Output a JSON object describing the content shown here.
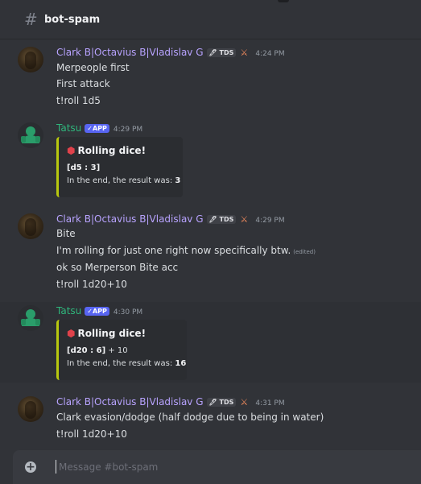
{
  "channel": {
    "name": "bot-spam"
  },
  "badges": {
    "tds": "TDS",
    "app": "✓APP"
  },
  "messages": [
    {
      "author": "Clark B|Octavius B|Vladislav G",
      "time": "4:24 PM",
      "lines": [
        "Merpeople first",
        "First attack",
        "t!roll 1d5"
      ]
    },
    {
      "author": "Tatsu",
      "time": "4:29 PM",
      "embed": {
        "title": "Rolling dice!",
        "detail_dice": "[d5 : 3]",
        "detail_rest": "",
        "result_prefix": "In the end, the result was: ",
        "result": "3"
      }
    },
    {
      "author": "Clark B|Octavius B|Vladislav G",
      "time": "4:29 PM",
      "lines": [
        "Bite",
        "I'm rolling for just one right now specifically btw.",
        "ok so Merperson Bite acc",
        "t!roll 1d20+10"
      ],
      "edited": "(edited)"
    },
    {
      "author": "Tatsu",
      "time": "4:30 PM",
      "embed": {
        "title": "Rolling dice!",
        "detail_dice": "[d20 : 6]",
        "detail_rest": " + 10",
        "result_prefix": "In the end, the result was: ",
        "result": "16"
      }
    },
    {
      "author": "Clark B|Octavius B|Vladislav G",
      "time": "4:31 PM",
      "lines": [
        "Clark evasion/dodge (half dodge due to being in water)",
        "t!roll 1d20+10"
      ]
    }
  ],
  "composer": {
    "placeholder": "Message #bot-spam"
  },
  "colors": {
    "clark_name": "#b8a3ff",
    "tatsu_name": "#2fb67c",
    "app_badge": "#5865f2",
    "embed_accent": "#b8c80f"
  },
  "icons": {
    "channel": "hash-icon",
    "add": "plus-circle-icon",
    "dice": "dice-icon",
    "role": "sword-icon",
    "check": "check-icon"
  }
}
